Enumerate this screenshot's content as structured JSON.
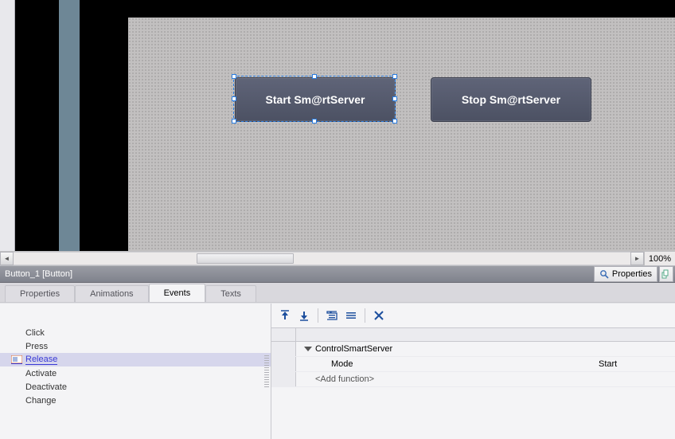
{
  "canvas": {
    "button1_label": "Start Sm@rtServer",
    "button2_label": "Stop Sm@rtServer"
  },
  "zoom": {
    "value": "100%"
  },
  "inspector": {
    "title": "Button_1 [Button]",
    "pane_toggle_label": "Properties"
  },
  "tabs": {
    "properties": "Properties",
    "animations": "Animations",
    "events": "Events",
    "texts": "Texts"
  },
  "events": {
    "click": "Click",
    "press": "Press",
    "release": "Release",
    "activate": "Activate",
    "deactivate": "Deactivate",
    "change": "Change"
  },
  "functions": {
    "row1_name": "ControlSmartServer",
    "row2_param": "Mode",
    "row2_value": "Start",
    "add_placeholder": "<Add function>"
  }
}
